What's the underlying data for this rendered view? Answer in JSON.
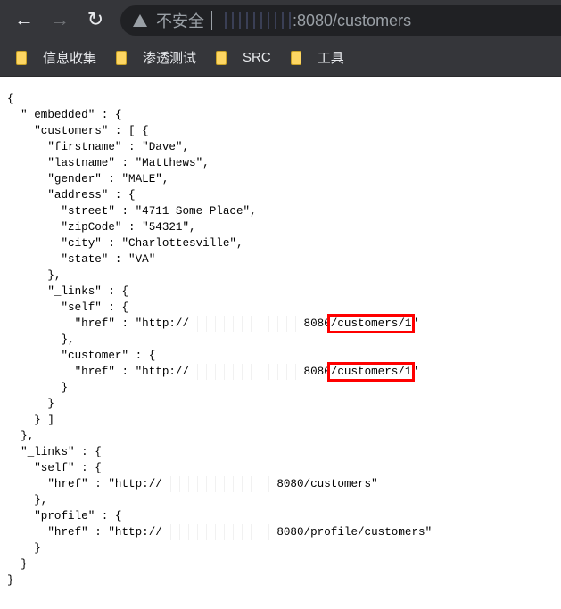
{
  "browser": {
    "security_label": "不安全",
    "url_visible": ":8080/customers",
    "bookmarks": [
      {
        "label": "信息收集"
      },
      {
        "label": "渗透测试"
      },
      {
        "label": "SRC"
      },
      {
        "label": "工具"
      }
    ]
  },
  "json_lines": [
    {
      "t": "{"
    },
    {
      "t": "  \"_embedded\" : {"
    },
    {
      "t": "    \"customers\" : [ {"
    },
    {
      "t": "      \"firstname\" : \"Dave\","
    },
    {
      "t": "      \"lastname\" : \"Matthews\","
    },
    {
      "t": "      \"gender\" : \"MALE\","
    },
    {
      "t": "      \"address\" : {"
    },
    {
      "t": "        \"street\" : \"4711 Some Place\","
    },
    {
      "t": "        \"zipCode\" : \"54321\","
    },
    {
      "t": "        \"city\" : \"Charlottesville\","
    },
    {
      "t": "        \"state\" : \"VA\""
    },
    {
      "t": "      },"
    },
    {
      "t": "      \"_links\" : {"
    },
    {
      "t": "        \"self\" : {"
    },
    {
      "t": "          \"href\" : \"http://",
      "r": "xxxxxxxxxxxxxxxxx",
      "a": "8080",
      "h": "/customers/1",
      "e": "\""
    },
    {
      "t": "        },"
    },
    {
      "t": "        \"customer\" : {"
    },
    {
      "t": "          \"href\" : \"http://",
      "r": "xxxxxxxxxxxxxxxxx",
      "a": "8080",
      "h": "/customers/1",
      "e": "\""
    },
    {
      "t": "        }"
    },
    {
      "t": "      }"
    },
    {
      "t": "    } ]"
    },
    {
      "t": "  },"
    },
    {
      "t": "  \"_links\" : {"
    },
    {
      "t": "    \"self\" : {"
    },
    {
      "t": "      \"href\" : \"http://",
      "r": "xxxxxxxxxxxxxxxxx",
      "a": "8080/customers\""
    },
    {
      "t": "    },"
    },
    {
      "t": "    \"profile\" : {"
    },
    {
      "t": "      \"href\" : \"http://",
      "r": "xxxxxxxxxxxxxxxxx",
      "a": "8080/profile/customers\""
    },
    {
      "t": "    }"
    },
    {
      "t": "  }"
    },
    {
      "t": "}"
    }
  ]
}
